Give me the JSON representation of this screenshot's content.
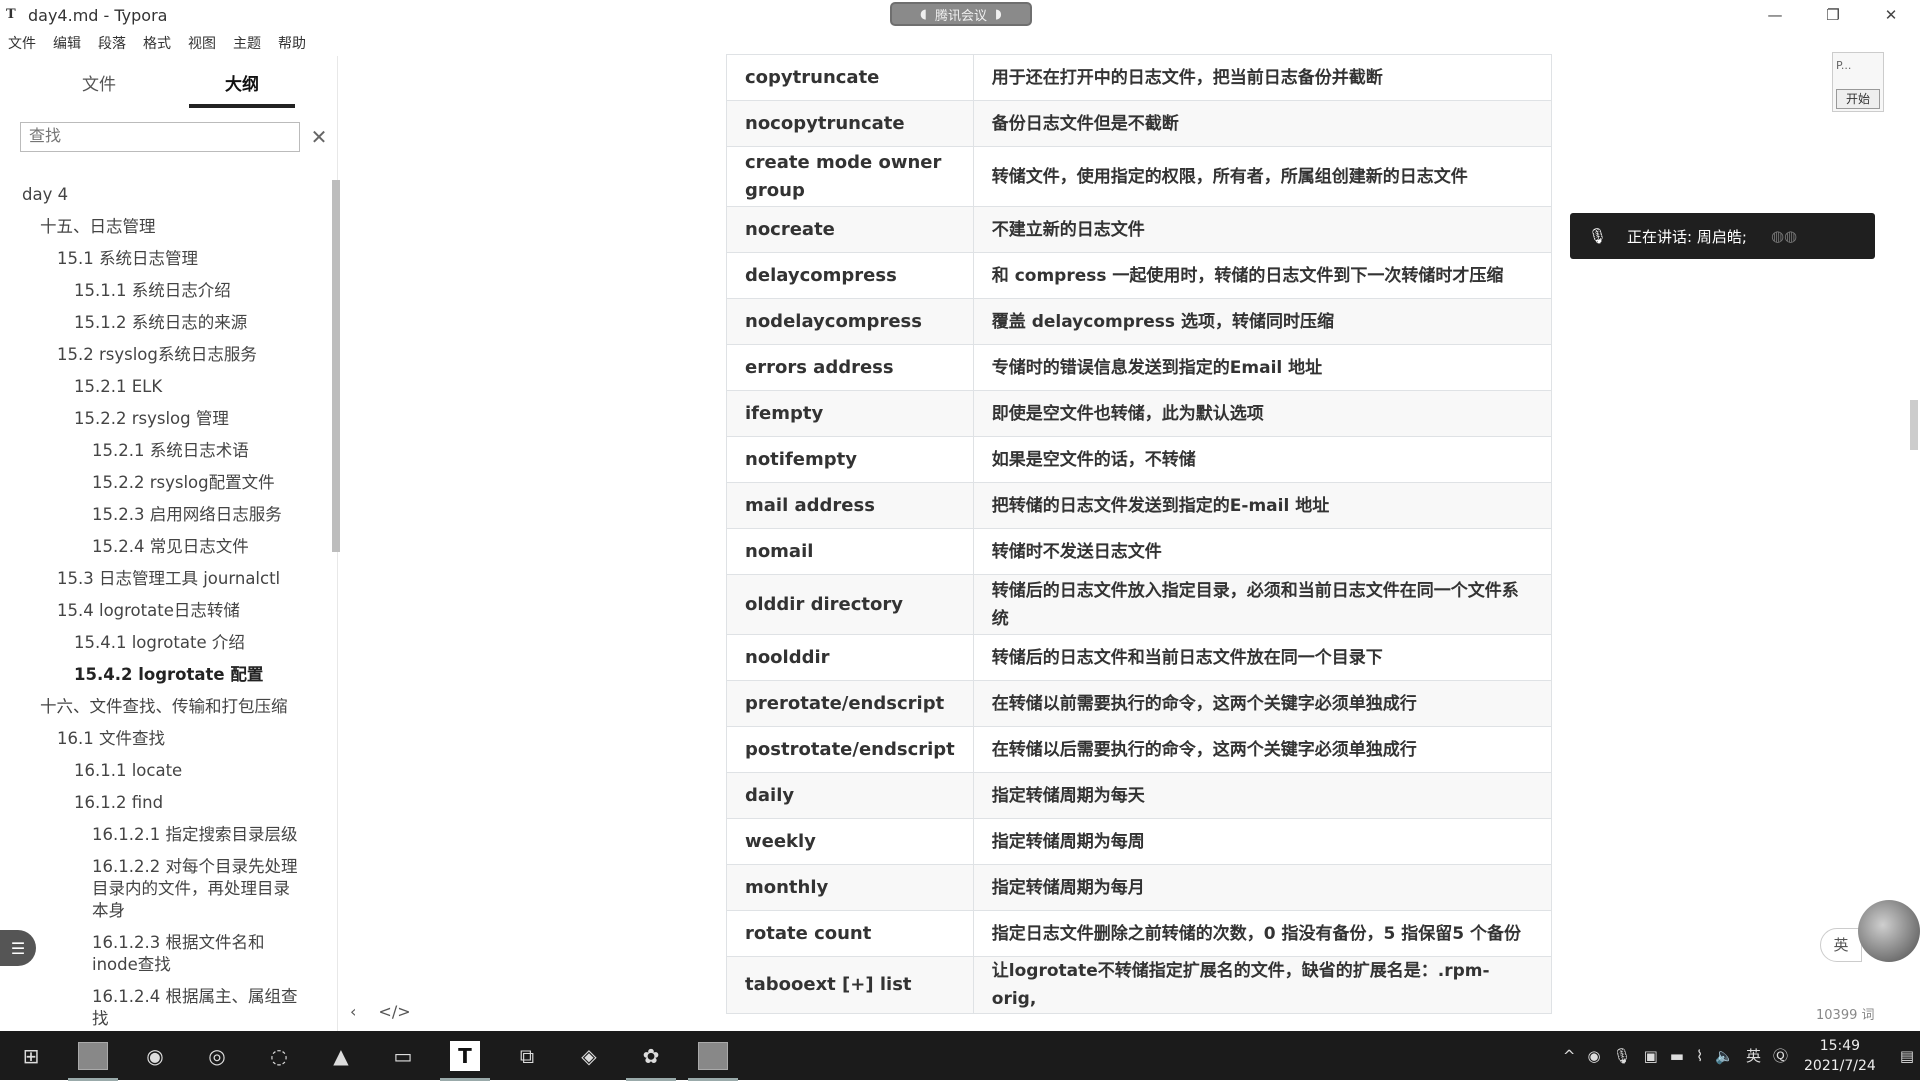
{
  "window": {
    "app_icon": "T",
    "title": "day4.md - Typora",
    "minimize": "—",
    "restore": "❐",
    "close": "✕"
  },
  "meeting": {
    "label": "腾讯会议"
  },
  "menu": [
    "文件",
    "编辑",
    "段落",
    "格式",
    "视图",
    "主题",
    "帮助"
  ],
  "sidebar": {
    "tabs": [
      "文件",
      "大纲"
    ],
    "active_tab": "大纲",
    "search_placeholder": "查找",
    "search_clear": "✕",
    "outline": [
      {
        "text": "day 4",
        "level": 0
      },
      {
        "text": "十五、日志管理",
        "level": 1
      },
      {
        "text": "15.1 系统日志管理",
        "level": 2
      },
      {
        "text": "15.1.1 系统日志介绍",
        "level": 3
      },
      {
        "text": "15.1.2 系统日志的来源",
        "level": 3
      },
      {
        "text": "15.2 rsyslog系统日志服务",
        "level": 2
      },
      {
        "text": "15.2.1 ELK",
        "level": 3
      },
      {
        "text": "15.2.2 rsyslog 管理",
        "level": 3
      },
      {
        "text": "15.2.1 系统日志术语",
        "level": 4
      },
      {
        "text": "15.2.2 rsyslog配置文件",
        "level": 4
      },
      {
        "text": "15.2.3 启用网络日志服务",
        "level": 4
      },
      {
        "text": "15.2.4 常见日志文件",
        "level": 4
      },
      {
        "text": "15.3 日志管理工具 journalctl",
        "level": 2
      },
      {
        "text": "15.4 logrotate日志转储",
        "level": 2
      },
      {
        "text": "15.4.1 logrotate 介绍",
        "level": 3
      },
      {
        "text": "15.4.2 logrotate 配置",
        "level": 3,
        "bold": true
      },
      {
        "text": "十六、文件查找、传输和打包压缩",
        "level": 1
      },
      {
        "text": "16.1 文件查找",
        "level": 2
      },
      {
        "text": "16.1.1 locate",
        "level": 3
      },
      {
        "text": "16.1.2 find",
        "level": 3
      },
      {
        "text": "16.1.2.1 指定搜索目录层级",
        "level": 4
      },
      {
        "text": "16.1.2.2 对每个目录先处理目录内的文件，再处理目录本身",
        "level": 4,
        "lines": 3
      },
      {
        "text": "16.1.2.3 根据文件名和inode查找",
        "level": 4,
        "lines": 2
      },
      {
        "text": "16.1.2.4 根据属主、属组查找",
        "level": 4,
        "lines": 2
      }
    ]
  },
  "table": [
    {
      "key": "copytruncate",
      "val": "用于还在打开中的日志文件，把当前日志备份并截断"
    },
    {
      "key": "nocopytruncate",
      "val": "备份日志文件但是不截断"
    },
    {
      "key": "create mode owner group",
      "val": "转储文件，使用指定的权限，所有者，所属组创建新的日志文件"
    },
    {
      "key": "nocreate",
      "val": "不建立新的日志文件"
    },
    {
      "key": "delaycompress",
      "val": "和 compress 一起使用时，转储的日志文件到下一次转储时才压缩"
    },
    {
      "key": "nodelaycompress",
      "val": "覆盖 delaycompress 选项，转储同时压缩"
    },
    {
      "key": "errors address",
      "val": "专储时的错误信息发送到指定的Email 地址"
    },
    {
      "key": "ifempty",
      "val": "即使是空文件也转储，此为默认选项"
    },
    {
      "key": "notifempty",
      "val": "如果是空文件的话，不转储"
    },
    {
      "key": "mail address",
      "val": "把转储的日志文件发送到指定的E-mail 地址"
    },
    {
      "key": "nomail",
      "val": "转储时不发送日志文件"
    },
    {
      "key": "olddir directory",
      "val": "转储后的日志文件放入指定目录，必须和当前日志文件在同一个文件系统"
    },
    {
      "key": "noolddir",
      "val": "转储后的日志文件和当前日志文件放在同一个目录下"
    },
    {
      "key": "prerotate/endscript",
      "val": "在转储以前需要执行的命令，这两个关键字必须单独成行"
    },
    {
      "key": "postrotate/endscript",
      "val": "在转储以后需要执行的命令，这两个关键字必须单独成行"
    },
    {
      "key": "daily",
      "val": "指定转储周期为每天"
    },
    {
      "key": "weekly",
      "val": "指定转储周期为每周"
    },
    {
      "key": "monthly",
      "val": "指定转储周期为每月"
    },
    {
      "key": "rotate count",
      "val": "指定日志文件删除之前转储的次数，0 指没有备份，5 指保留5 个备份"
    },
    {
      "key": "tabooext [+] list",
      "val": "让logrotate不转储指定扩展名的文件，缺省的扩展名是：.rpm-orig,"
    }
  ],
  "editor": {
    "prev": "‹",
    "source_toggle": "</>",
    "word_count": "10399 词"
  },
  "speaking": {
    "label": "正在讲话: 周启皓;"
  },
  "mini_panel": {
    "p": "P...",
    "start": "开始"
  },
  "lang": "英",
  "taskbar": {
    "tray_lang": "英",
    "time": "15:49",
    "date": "2021/7/24"
  }
}
